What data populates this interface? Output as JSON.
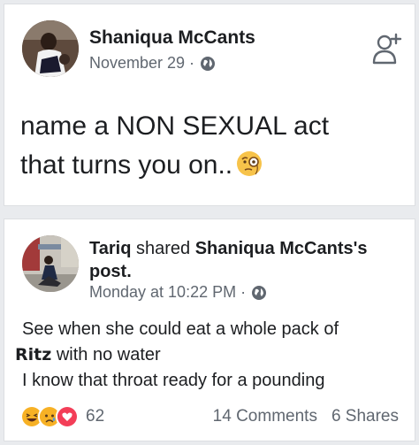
{
  "original_post": {
    "author": "Shaniqua McCants",
    "date": "November 29 ·",
    "privacy_icon": "globe-icon",
    "action_icon": "add-friend-icon",
    "text_line1": "name a NON SEXUAL act",
    "text_line2": "that turns you on..",
    "emoji": "face-with-monocle"
  },
  "shared_post": {
    "sharer": "Tariq",
    "shared_word": "shared",
    "original_author_possessive": "Shaniqua McCants's",
    "post_word": "post.",
    "date": "Monday at 10:22 PM ·",
    "privacy_icon": "globe-icon",
    "text_line1": "See when she could eat a whole pack of",
    "text_line2_bold": "Ritz",
    "text_line2_rest": " with no water",
    "text_line3": "I know that throat ready for a pounding",
    "reactions": [
      "haha",
      "sad",
      "love"
    ],
    "reaction_count": "62",
    "comments": "14 Comments",
    "shares": "6 Shares"
  },
  "colors": {
    "background": "#e9ebee",
    "card": "#ffffff",
    "text": "#1c1e21",
    "meta": "#606770",
    "love": "#f33e58",
    "haha": "#f7b125"
  }
}
